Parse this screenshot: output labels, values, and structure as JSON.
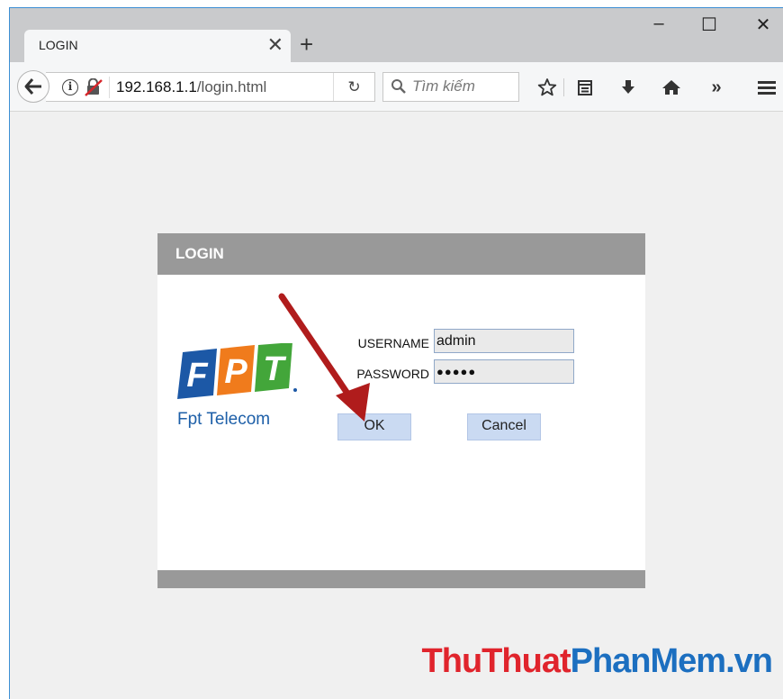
{
  "browser": {
    "tab_title": "LOGIN",
    "tab_close_icon": "close-icon",
    "new_tab_symbol": "+",
    "window_controls": {
      "minimize": "–",
      "maximize": "☐",
      "close": "✕"
    },
    "url_host": "192.168.1.1",
    "url_path": "/login.html",
    "reload_symbol": "C",
    "search_placeholder": "Tìm kiếm",
    "overflow_symbol": "»"
  },
  "dialog": {
    "title": "LOGIN",
    "logo_tagline": "Fpt Telecom",
    "logo_letters": [
      "F",
      "P",
      "T"
    ],
    "username_label": "USERNAME",
    "username_value": "admin",
    "password_label": "PASSWORD",
    "password_value": "●●●●●",
    "ok_label": "OK",
    "cancel_label": "Cancel"
  },
  "watermark": {
    "part1": "ThuThuat",
    "part2": "PhanMem.vn"
  },
  "colors": {
    "dialog_header": "#999999",
    "button_bg": "#cadaf2",
    "logo_blue": "#1c58a6",
    "logo_orange": "#f07b1c",
    "logo_green": "#43a63a",
    "arrow_red": "#b01c1c",
    "watermark_red": "#e0242c",
    "watermark_blue": "#1c6fc0"
  }
}
